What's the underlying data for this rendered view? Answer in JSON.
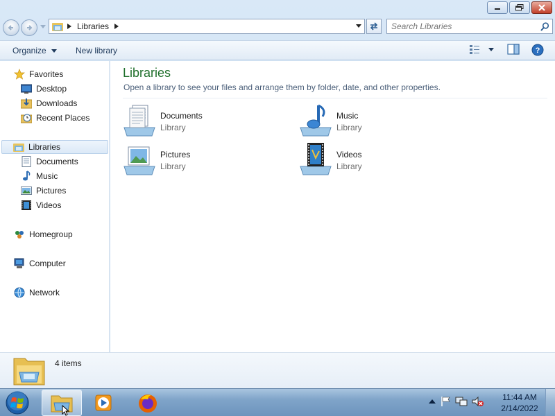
{
  "window": {
    "caption_buttons": [
      "minimize",
      "maximize",
      "close"
    ]
  },
  "address_bar": {
    "crumb": "Libraries",
    "search_placeholder": "Search Libraries"
  },
  "command_bar": {
    "organize": "Organize",
    "new_library": "New library"
  },
  "nav_pane": {
    "favorites": {
      "label": "Favorites",
      "icon": "star-icon"
    },
    "favorite_items": [
      {
        "label": "Desktop",
        "icon": "desktop-icon"
      },
      {
        "label": "Downloads",
        "icon": "downloads-icon"
      },
      {
        "label": "Recent Places",
        "icon": "recent-places-icon"
      }
    ],
    "libraries": {
      "label": "Libraries",
      "icon": "libraries-icon",
      "selected": true
    },
    "library_items": [
      {
        "label": "Documents",
        "icon": "documents-icon"
      },
      {
        "label": "Music",
        "icon": "music-icon"
      },
      {
        "label": "Pictures",
        "icon": "pictures-icon"
      },
      {
        "label": "Videos",
        "icon": "videos-icon"
      }
    ],
    "homegroup": {
      "label": "Homegroup",
      "icon": "homegroup-icon"
    },
    "computer": {
      "label": "Computer",
      "icon": "computer-icon"
    },
    "network": {
      "label": "Network",
      "icon": "network-icon"
    }
  },
  "main": {
    "title": "Libraries",
    "subtitle": "Open a library to see your files and arrange them by folder, date, and other properties.",
    "libraries": [
      {
        "name": "Documents",
        "type": "Library",
        "icon": "documents-library-icon"
      },
      {
        "name": "Music",
        "type": "Library",
        "icon": "music-library-icon"
      },
      {
        "name": "Pictures",
        "type": "Library",
        "icon": "pictures-library-icon"
      },
      {
        "name": "Videos",
        "type": "Library",
        "icon": "videos-library-icon"
      }
    ]
  },
  "details": {
    "count": "4 items"
  },
  "taskbar": {
    "apps": [
      {
        "name": "Windows Explorer",
        "icon": "explorer-icon",
        "active": true
      },
      {
        "name": "Windows Media Player",
        "icon": "media-player-icon",
        "active": false
      },
      {
        "name": "Firefox",
        "icon": "firefox-icon",
        "active": false
      }
    ],
    "tray_icons": [
      "show-hidden-icons",
      "action-center-flag-icon",
      "network-icon",
      "volume-muted-icon"
    ],
    "time": "11:44 AM",
    "date": "2/14/2022"
  },
  "colors": {
    "title_green": "#1e6e2a",
    "taskbar": "#7fa4c9",
    "selection": "#dbe9f7"
  }
}
